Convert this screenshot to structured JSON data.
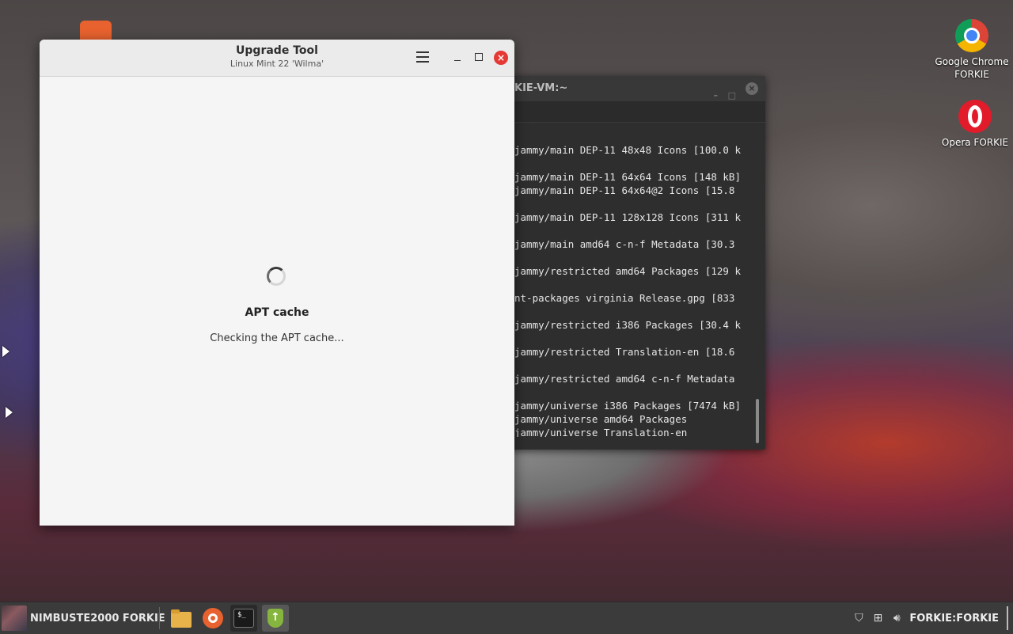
{
  "desktop": {
    "icons": [
      {
        "label": "Google Chrome FORKIE",
        "icon": "chrome-icon"
      },
      {
        "label": "Opera FORKIE",
        "icon": "opera-icon"
      }
    ]
  },
  "terminal": {
    "title": "KIE-VM:~",
    "lines": [
      "jammy/main DEP-11 48x48 Icons [100.0 k",
      "jammy/main DEP-11 64x64 Icons [148 kB]",
      "jammy/main DEP-11 64x64@2 Icons [15.8",
      "jammy/main DEP-11 128x128 Icons [311 k",
      "jammy/main amd64 c-n-f Metadata [30.3",
      "jammy/restricted amd64 Packages [129 k",
      "nt-packages virginia Release.gpg [833",
      "jammy/restricted i386 Packages [30.4 k",
      "jammy/restricted Translation-en [18.6",
      "jammy/restricted amd64 c-n-f Metadata",
      "jammy/universe i386 Packages [7474 kB]",
      "jammy/universe amd64 Packages",
      "jammy/universe Translation-en"
    ]
  },
  "upgrade_tool": {
    "title": "Upgrade Tool",
    "subtitle": "Linux Mint 22 'Wilma'",
    "status_title": "APT cache",
    "status_text": "Checking the APT cache..."
  },
  "taskbar": {
    "menu_label": "NIMBUSTE2000 FORKIE",
    "apps": [
      "folder-icon",
      "firefox-icon",
      "terminal-icon",
      "upgrade-tool-icon"
    ],
    "terminal_glyph": "$_",
    "upgrade_glyph": "↑",
    "tray_user": "FORKIE:FORKIE"
  }
}
